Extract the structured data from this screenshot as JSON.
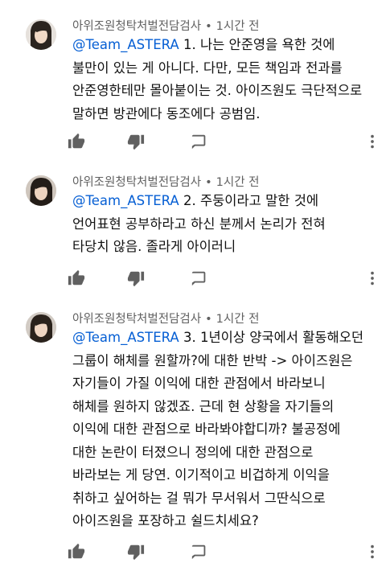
{
  "comments": [
    {
      "author": "아위조원청탁처벌전담검사",
      "separator": "•",
      "time": "1시간 전",
      "mention": "@Team_ASTERA",
      "lines": [
        " 1. 나는 안준영을 욕한 것에",
        "불만이 있는 게 아니다. 다만, 모든 책임과 전과를",
        "안준영한테만 몰아붙이는 것. 아이즈원도 극단적으로",
        "말하면 방관에다 동조에다 공범임."
      ]
    },
    {
      "author": "아위조원청탁처벌전담검사",
      "separator": "•",
      "time": "1시간 전",
      "mention": "@Team_ASTERA",
      "lines": [
        " 2. 주둥이라고 말한 것에",
        "언어표현 공부하라고 하신 분께서 논리가 전혀",
        "타당치 않음. 졸라게 아이러니"
      ]
    },
    {
      "author": "아위조원청탁처벌전담검사",
      "separator": "•",
      "time": "1시간 전",
      "mention": "@Team_ASTERA",
      "lines": [
        " 3. 1년이상 양국에서 활동해오던",
        "그룹이 해체를 원할까?에 대한 반박 -> 아이즈원은",
        "자기들이 가질 이익에 대한 관점에서 바라보니",
        "해체를 원하지 않겠죠. 근데 현 상황을 자기들의",
        "이익에 대한 관점으로 바라봐야합디까? 불공정에",
        "대한 논란이 터졌으니 정의에 대한 관점으로",
        "바라보는 게 당연. 이기적이고 비겁하게 이익을",
        "취하고 싶어하는 걸 뭐가 무서워서 그딴식으로",
        "아이즈원을 포장하고 쉴드치세요?"
      ]
    }
  ],
  "icons": {
    "avatar": "avatar-photo",
    "like": "thumbs-up-icon",
    "dislike": "thumbs-down-icon",
    "reply": "reply-icon",
    "more": "more-vertical-icon"
  },
  "colors": {
    "mention": "#065fd4",
    "meta": "#606060",
    "text": "#111111",
    "icon": "#606060"
  }
}
